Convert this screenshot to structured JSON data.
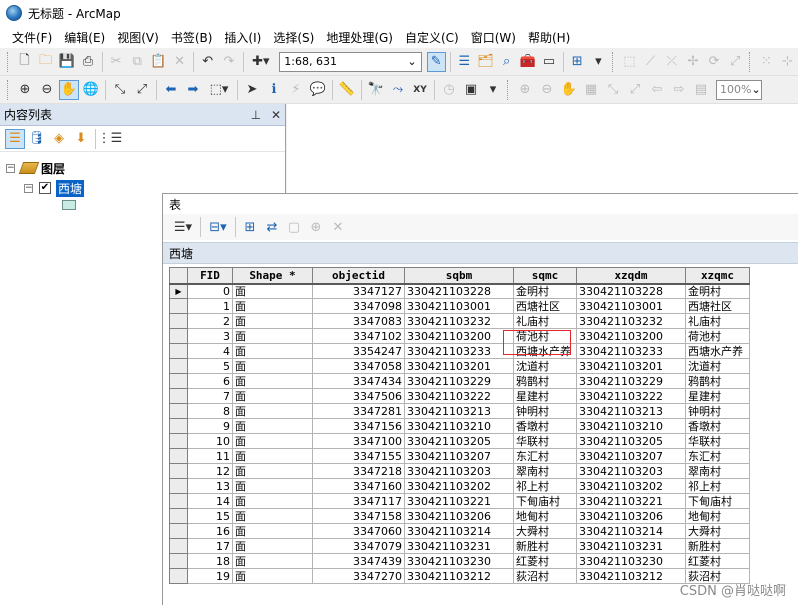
{
  "window": {
    "title": "无标题 - ArcMap"
  },
  "menu": [
    "文件(F)",
    "编辑(E)",
    "视图(V)",
    "书签(B)",
    "插入(I)",
    "选择(S)",
    "地理处理(G)",
    "自定义(C)",
    "窗口(W)",
    "帮助(H)"
  ],
  "toolbar": {
    "scale": "1:68, 631",
    "zoom": "100%"
  },
  "toc": {
    "title": "内容列表",
    "pin": "ᵠ",
    "close": "×",
    "root_label": "图层",
    "layer_label": "西塘"
  },
  "table_window": {
    "title": "表",
    "table_name": "西塘",
    "columns": [
      "FID",
      "Shape *",
      "objectid",
      "sqbm",
      "sqmc",
      "xzqdm",
      "xzqmc"
    ],
    "highlighted_column": "sqmc",
    "rows": [
      [
        "0",
        "面",
        "3347127",
        "330421103228",
        "金明村",
        "330421103228",
        "金明村"
      ],
      [
        "1",
        "面",
        "3347098",
        "330421103001",
        "西塘社区",
        "330421103001",
        "西塘社区"
      ],
      [
        "2",
        "面",
        "3347083",
        "330421103232",
        "礼庙村",
        "330421103232",
        "礼庙村"
      ],
      [
        "3",
        "面",
        "3347102",
        "330421103200",
        "荷池村",
        "330421103200",
        "荷池村"
      ],
      [
        "4",
        "面",
        "3354247",
        "330421103233",
        "西塘水产养",
        "330421103233",
        "西塘水产养"
      ],
      [
        "5",
        "面",
        "3347058",
        "330421103201",
        "沈道村",
        "330421103201",
        "沈道村"
      ],
      [
        "6",
        "面",
        "3347434",
        "330421103229",
        "鸦鹊村",
        "330421103229",
        "鸦鹊村"
      ],
      [
        "7",
        "面",
        "3347506",
        "330421103222",
        "星建村",
        "330421103222",
        "星建村"
      ],
      [
        "8",
        "面",
        "3347281",
        "330421103213",
        "钟明村",
        "330421103213",
        "钟明村"
      ],
      [
        "9",
        "面",
        "3347156",
        "330421103210",
        "香墩村",
        "330421103210",
        "香墩村"
      ],
      [
        "10",
        "面",
        "3347100",
        "330421103205",
        "华联村",
        "330421103205",
        "华联村"
      ],
      [
        "11",
        "面",
        "3347155",
        "330421103207",
        "东汇村",
        "330421103207",
        "东汇村"
      ],
      [
        "12",
        "面",
        "3347218",
        "330421103203",
        "翠南村",
        "330421103203",
        "翠南村"
      ],
      [
        "13",
        "面",
        "3347160",
        "330421103202",
        "祁上村",
        "330421103202",
        "祁上村"
      ],
      [
        "14",
        "面",
        "3347117",
        "330421103221",
        "下甸庙村",
        "330421103221",
        "下甸庙村"
      ],
      [
        "15",
        "面",
        "3347158",
        "330421103206",
        "地甸村",
        "330421103206",
        "地甸村"
      ],
      [
        "16",
        "面",
        "3347060",
        "330421103214",
        "大舜村",
        "330421103214",
        "大舜村"
      ],
      [
        "17",
        "面",
        "3347079",
        "330421103231",
        "新胜村",
        "330421103231",
        "新胜村"
      ],
      [
        "18",
        "面",
        "3347439",
        "330421103230",
        "红菱村",
        "330421103230",
        "红菱村"
      ],
      [
        "19",
        "面",
        "3347270",
        "330421103212",
        "荻沼村",
        "330421103212",
        "荻沼村"
      ]
    ]
  },
  "watermark": "CSDN @肖哒哒啊",
  "colors": {
    "selection": "#0a64c8",
    "highlight_box": "#e0282e",
    "toc_header": "#dbe5f1"
  }
}
